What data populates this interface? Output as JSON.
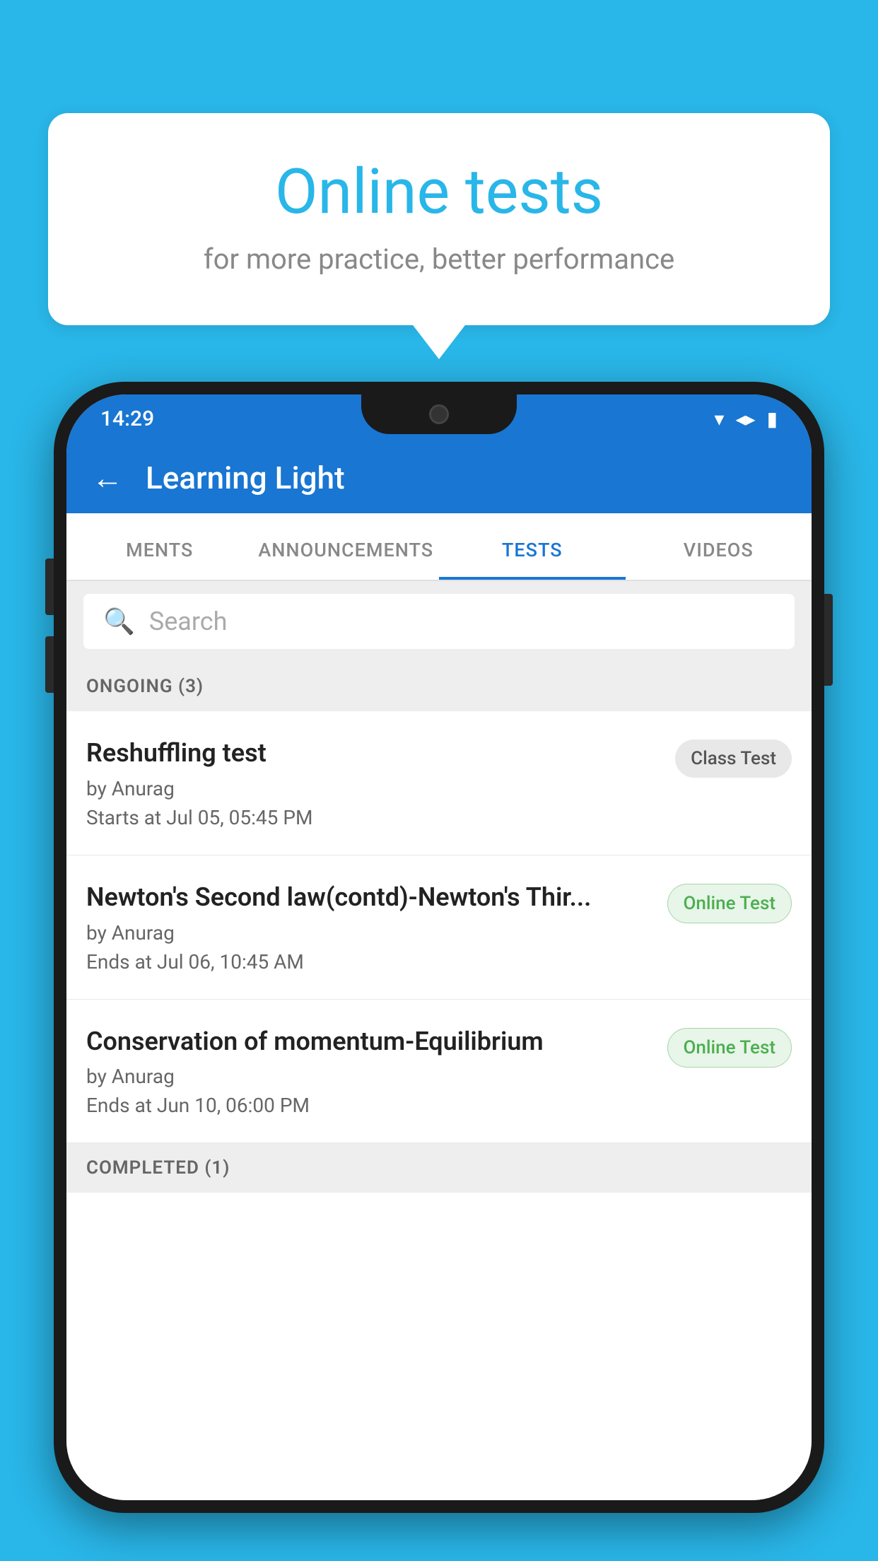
{
  "background": {
    "color": "#29b6e8"
  },
  "speech_bubble": {
    "title": "Online tests",
    "subtitle": "for more practice, better performance"
  },
  "phone": {
    "status_bar": {
      "time": "14:29",
      "wifi": "▼",
      "signal": "▲",
      "battery": "▮"
    },
    "header": {
      "back_label": "←",
      "title": "Learning Light"
    },
    "tabs": [
      {
        "label": "MENTS",
        "active": false
      },
      {
        "label": "ANNOUNCEMENTS",
        "active": false
      },
      {
        "label": "TESTS",
        "active": true
      },
      {
        "label": "VIDEOS",
        "active": false
      }
    ],
    "search": {
      "placeholder": "Search"
    },
    "ongoing_section": {
      "label": "ONGOING (3)"
    },
    "tests": [
      {
        "name": "Reshuffling test",
        "author": "by Anurag",
        "time_label": "Starts at",
        "time": "Jul 05, 05:45 PM",
        "badge": "Class Test",
        "badge_type": "class"
      },
      {
        "name": "Newton's Second law(contd)-Newton's Thir...",
        "author": "by Anurag",
        "time_label": "Ends at",
        "time": "Jul 06, 10:45 AM",
        "badge": "Online Test",
        "badge_type": "online"
      },
      {
        "name": "Conservation of momentum-Equilibrium",
        "author": "by Anurag",
        "time_label": "Ends at",
        "time": "Jun 10, 06:00 PM",
        "badge": "Online Test",
        "badge_type": "online"
      }
    ],
    "completed_section": {
      "label": "COMPLETED (1)"
    }
  }
}
